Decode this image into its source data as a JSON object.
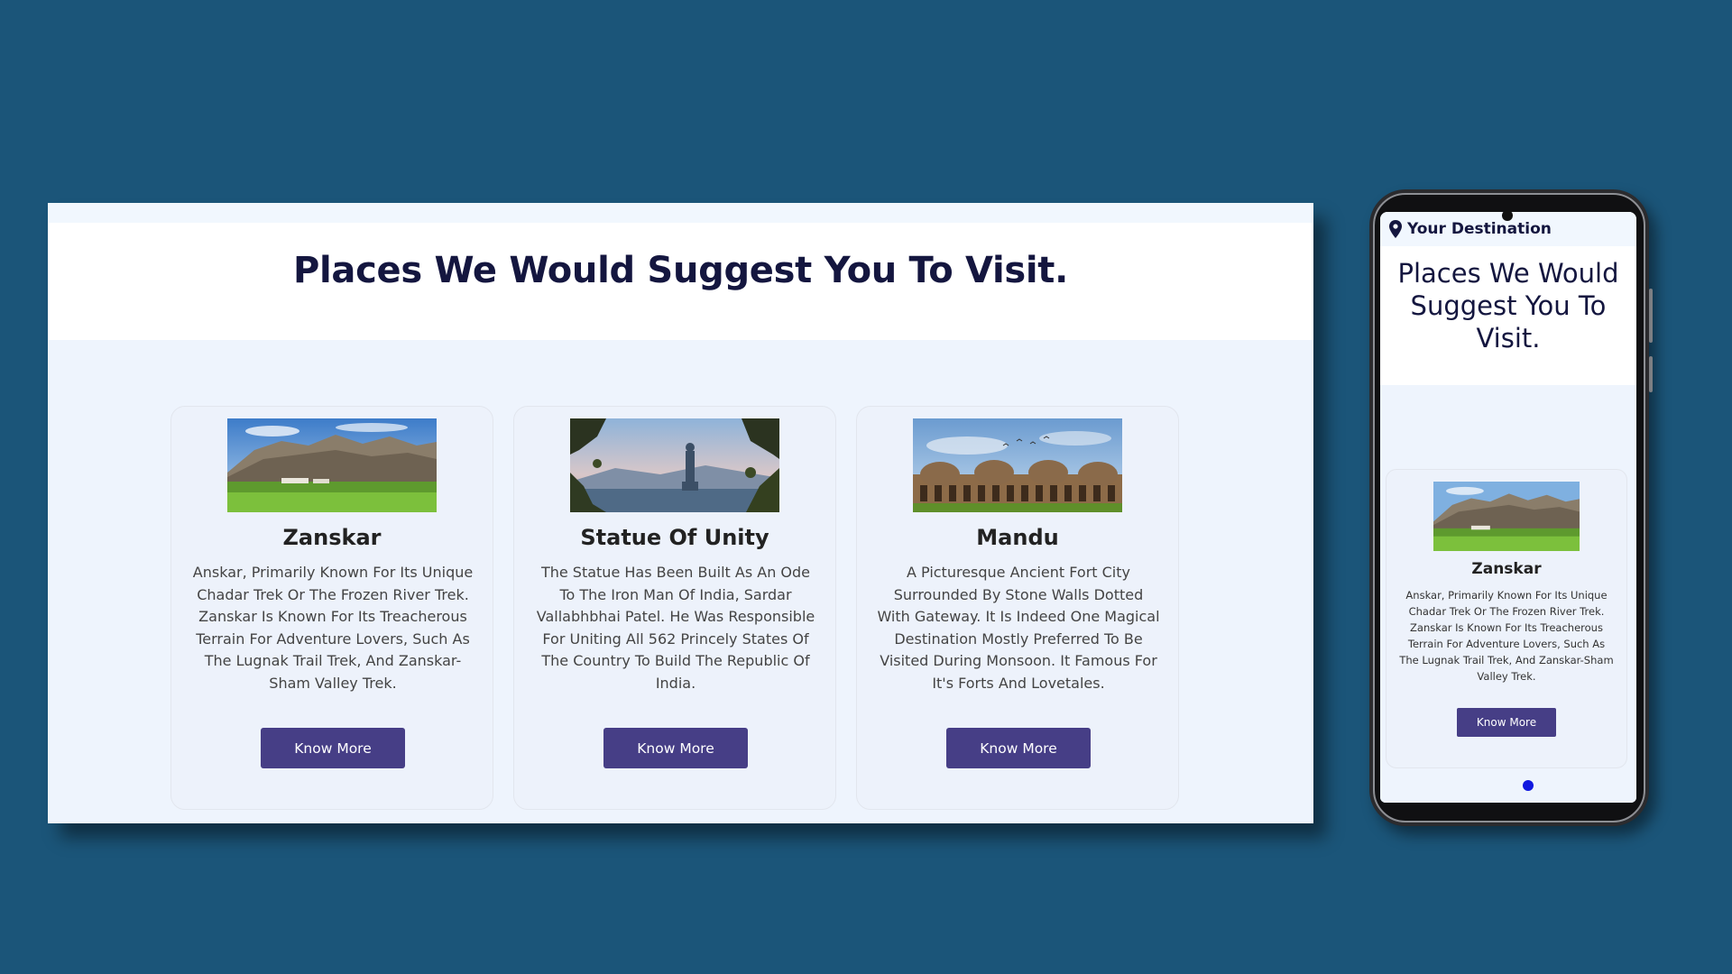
{
  "desktop": {
    "heading": "Places We Would Suggest You To Visit.",
    "cards": [
      {
        "title": "Zanskar",
        "description": "Anskar, Primarily Known For Its Unique Chadar Trek Or The Frozen River Trek. Zanskar Is Known For Its Treacherous Terrain For Adventure Lovers, Such As The Lugnak Trail Trek, And Zanskar-Sham Valley Trek.",
        "button": "Know More",
        "image": "mountain-valley-photo"
      },
      {
        "title": "Statue Of Unity",
        "description": "The Statue Has Been Built As An Ode To The Iron Man Of India, Sardar Vallabhbhai Patel. He Was Responsible For Uniting All 562 Princely States Of The Country To Build The Republic Of India.",
        "button": "Know More",
        "image": "statue-photo"
      },
      {
        "title": "Mandu",
        "description": "A Picturesque Ancient Fort City Surrounded By Stone Walls Dotted With Gateway. It Is Indeed One Magical Destination Mostly Preferred To Be Visited During Monsoon. It Famous For It's Forts And Lovetales.",
        "button": "Know More",
        "image": "domed-fort-photo"
      }
    ]
  },
  "mobile": {
    "brand": "Your Destination",
    "brand_icon": "location-pin-icon",
    "heading": "Places We Would Suggest You To Visit.",
    "card": {
      "title": "Zanskar",
      "description": "Anskar, Primarily Known For Its Unique Chadar Trek Or The Frozen River Trek. Zanskar Is Known For Its Treacherous Terrain For Adventure Lovers, Such As The Lugnak Trail Trek, And Zanskar-Sham Valley Trek.",
      "button": "Know More",
      "image": "mountain-valley-photo"
    }
  },
  "colors": {
    "background": "#1b5579",
    "heading": "#14163f",
    "button": "#463e86",
    "dot": "#1018e0"
  }
}
